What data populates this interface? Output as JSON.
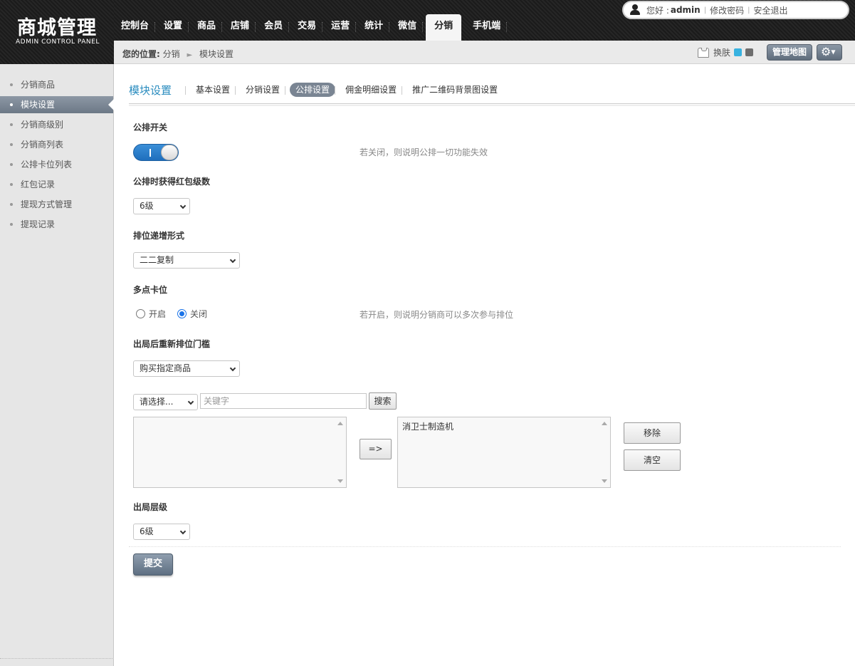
{
  "header": {
    "logo_title": "商城管理",
    "logo_subtitle": "ADMIN CONTROL PANEL",
    "nav": [
      "控制台",
      "设置",
      "商品",
      "店铺",
      "会员",
      "交易",
      "运营",
      "统计",
      "微信",
      "分销",
      "手机端"
    ],
    "active_nav": "分销",
    "user": {
      "greeting": "您好 :",
      "name": "admin",
      "change_password": "修改密码",
      "logout": "安全退出"
    }
  },
  "crumbbar": {
    "prefix": "您的位置:",
    "path": [
      "分销",
      "模块设置"
    ],
    "skin_label": "换肤",
    "skin_colors": [
      "#38b2e0",
      "#6e6e6e"
    ],
    "map_button": "管理地图",
    "gear_icon": "gear-icon"
  },
  "sidebar": {
    "items": [
      "分销商品",
      "模块设置",
      "分销商级别",
      "分销商列表",
      "公排卡位列表",
      "红包记录",
      "提现方式管理",
      "提现记录"
    ],
    "active": "模块设置"
  },
  "tabs": {
    "title": "模块设置",
    "items": [
      "基本设置",
      "分销设置",
      "公排设置",
      "佣金明细设置",
      "推广二维码背景图设置"
    ],
    "active": "公排设置"
  },
  "form": {
    "switch": {
      "label": "公排开关",
      "state": "on",
      "hint": "若关闭，则说明公排一切功能失效"
    },
    "red_packet_levels": {
      "label": "公排时获得红包级数",
      "value": "6级"
    },
    "rank_growth": {
      "label": "排位递增形式",
      "value": "二二复制"
    },
    "multi_slot": {
      "label": "多点卡位",
      "options": [
        "开启",
        "关闭"
      ],
      "selected": "关闭",
      "hint": "若开启，则说明分销商可以多次参与排位"
    },
    "rerank_threshold": {
      "label": "出局后重新排位门槛",
      "value": "购买指定商品"
    },
    "search": {
      "category_value": "请选择...",
      "keyword_placeholder": "关键字",
      "search_button": "搜索"
    },
    "transfer": {
      "move_button": "=>",
      "selected_items": [
        "消卫士制造机"
      ],
      "remove_button": "移除",
      "clear_button": "清空"
    },
    "exit_level": {
      "label": "出局层级",
      "value": "6级"
    },
    "submit": "提交"
  }
}
